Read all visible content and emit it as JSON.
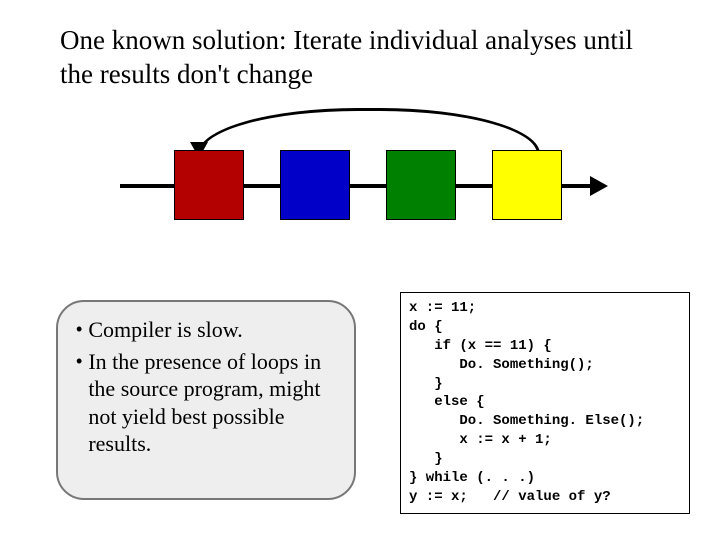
{
  "title": "One known solution: Iterate individual analyses until the results don't change",
  "bullets": {
    "b1": "Compiler is slow.",
    "b2": "In the presence of loops in the source program, might not yield best possible results."
  },
  "code": {
    "l1": "x := 11;",
    "l2": "do {",
    "l3": "   if (x == 11) {",
    "l4": "      Do. Something();",
    "l5": "   }",
    "l6": "   else {",
    "l7": "      Do. Something. Else();",
    "l8": "      x := x + 1;",
    "l9": "   }",
    "l10": "} while (. . .)",
    "l11": "y := x;   // value of y?"
  },
  "colors": {
    "box1": "#b30000",
    "box2": "#0000c8",
    "box3": "#008000",
    "box4": "#ffff00"
  }
}
